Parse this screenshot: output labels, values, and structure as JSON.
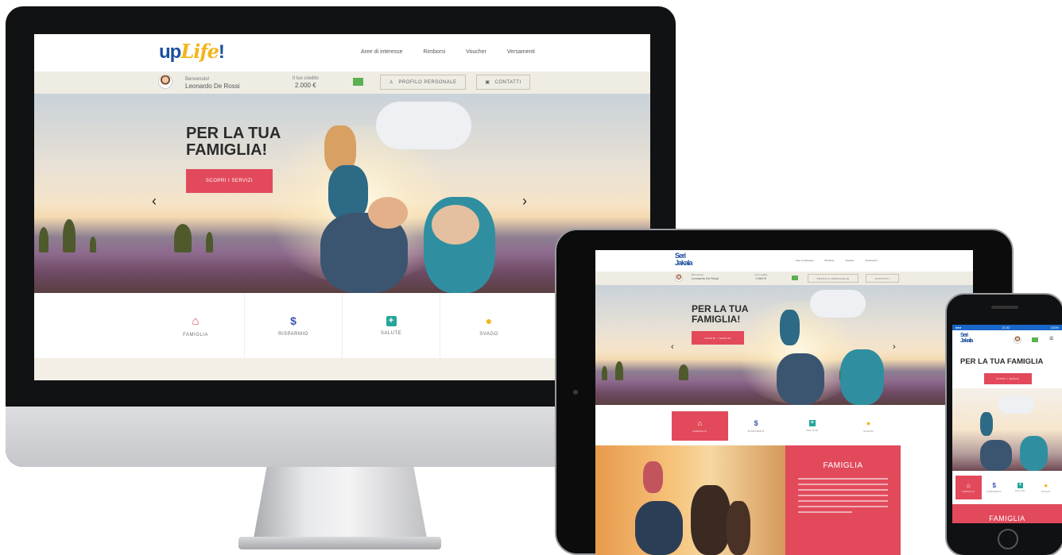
{
  "brand": {
    "logo_up": "up",
    "logo_life": "Life",
    "logo_bang": "!",
    "logo_seri": "Seri",
    "logo_jakala": "Jakala",
    "primary_color": "#e24a5c",
    "logo_blue": "#1d4fa0",
    "logo_yellow": "#f2b619"
  },
  "nav": {
    "items": [
      "Aree di interesse",
      "Rimborsi",
      "Voucher",
      "Versamenti"
    ]
  },
  "user": {
    "greeting": "Benvenuto!",
    "name": "Leonardo De Rossi",
    "credit_label": "Il tuo credito",
    "credit_value": "2.000 €"
  },
  "buttons": {
    "profile": "PROFILO PERSONALE",
    "contacts": "CONTATTI",
    "cta": "SCOPRI I SERVIZI"
  },
  "hero": {
    "title_line1": "PER LA TUA",
    "title_line2": "FAMIGLIA!",
    "mobile_title": "PER LA TUA FAMIGLIA"
  },
  "categories": [
    {
      "label": "FAMIGLIA",
      "icon": "home-icon",
      "color": "#e24a5c"
    },
    {
      "label": "RISPARMIO",
      "icon": "dollar-icon",
      "color": "#3f54b2"
    },
    {
      "label": "SALUTE",
      "icon": "plus-icon",
      "color": "#27a59b"
    },
    {
      "label": "SVAGO",
      "icon": "palette-icon",
      "color": "#f2b619"
    }
  ],
  "famiglia_section": {
    "title": "FAMIGLIA"
  },
  "phone_status": {
    "time": "21:32",
    "battery": "100%"
  }
}
